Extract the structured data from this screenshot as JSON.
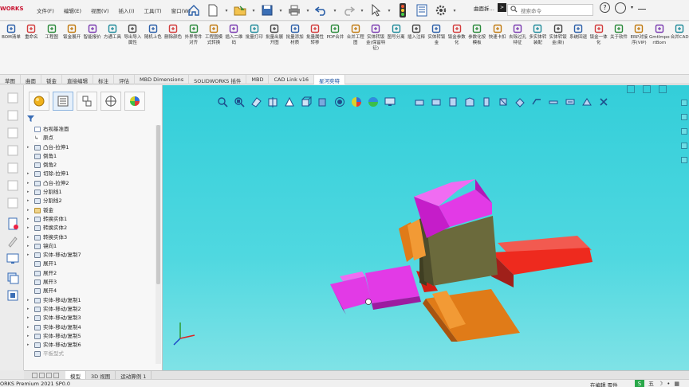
{
  "app": {
    "logo_text": "WORKS"
  },
  "menus": [
    "文件(F)",
    "编辑(E)",
    "视图(V)",
    "插入(I)",
    "工具(T)",
    "窗口(W)"
  ],
  "quick_access": [
    "home-icon",
    "new-file-icon",
    "open-folder-icon",
    "save-icon",
    "print-icon",
    "undo-icon",
    "redo-icon",
    "select-arrow-icon",
    "traffic-light-icon",
    "file-properties-icon",
    "options-gear-icon"
  ],
  "search": {
    "left_label": "曲面拆…",
    "placeholder": "搜索命令"
  },
  "commands": [
    {
      "label": "BOM清单",
      "icon": "bom-icon"
    },
    {
      "label": "重命名",
      "icon": "rename-icon"
    },
    {
      "label": "工程图",
      "icon": "drawing-icon"
    },
    {
      "label": "钣金展开",
      "icon": "sheetmetal-unfold-icon"
    },
    {
      "label": "智能报价",
      "icon": "quote-icon"
    },
    {
      "label": "方通工具",
      "icon": "tube-tool-icon"
    },
    {
      "label": "导出导入属性",
      "icon": "import-export-icon"
    },
    {
      "label": "随机上色",
      "icon": "random-color-icon"
    },
    {
      "label": "删除颜色",
      "icon": "delete-color-icon"
    },
    {
      "label": "外界零件对齐",
      "icon": "align-part-icon"
    },
    {
      "label": "工程图模式转换",
      "icon": "drawing-mode-icon"
    },
    {
      "label": "插入二维码",
      "icon": "qrcode-icon"
    },
    {
      "label": "批量打印",
      "icon": "batch-print-icon"
    },
    {
      "label": "批量出展开图",
      "icon": "batch-unfold-icon"
    },
    {
      "label": "批量添加材质",
      "icon": "batch-material-icon"
    },
    {
      "label": "批量属性转移",
      "icon": "batch-property-icon"
    },
    {
      "label": "PDF合并",
      "icon": "pdf-merge-icon"
    },
    {
      "label": "合并工程图",
      "icon": "merge-drawing-icon"
    },
    {
      "label": "实体转钣金(保留特征)",
      "icon": "solid-to-sheet-icon"
    },
    {
      "label": "图号分离",
      "icon": "number-split-icon"
    },
    {
      "label": "插入注释",
      "icon": "insert-note-icon"
    },
    {
      "label": "实体转钣金",
      "icon": "solid-to-sheetmetal-icon"
    },
    {
      "label": "钣金参数化",
      "icon": "sheet-param-icon"
    },
    {
      "label": "参数化按模板",
      "icon": "param-template-icon"
    },
    {
      "label": "快速卡扣",
      "icon": "snap-fit-icon"
    },
    {
      "label": "去除过孔特征",
      "icon": "remove-hole-icon"
    },
    {
      "label": "多实体转装配",
      "icon": "multibody-asm-icon"
    },
    {
      "label": "实体转钣金(新)",
      "icon": "solid-sheet-new-icon"
    },
    {
      "label": "系统回退",
      "icon": "system-rollback-icon"
    },
    {
      "label": "钣金一体化",
      "icon": "sheet-integrate-icon"
    },
    {
      "label": "关于软件",
      "icon": "about-icon"
    },
    {
      "label": "ERP对接序(VIP)",
      "icon": "erp-icon"
    },
    {
      "label": "GmtImportBom",
      "icon": "gmt-import-icon"
    },
    {
      "label": "合并CAD",
      "icon": "merge-cad-icon"
    }
  ],
  "tabs": [
    {
      "label": "草图",
      "active": false
    },
    {
      "label": "曲面",
      "active": false
    },
    {
      "label": "钣金",
      "active": false
    },
    {
      "label": "直接编辑",
      "active": false
    },
    {
      "label": "标注",
      "active": false
    },
    {
      "label": "评估",
      "active": false
    },
    {
      "label": "MBD Dimensions",
      "active": false
    },
    {
      "label": "SOLIDWORKS 插件",
      "active": false
    },
    {
      "label": "MBD",
      "active": false
    },
    {
      "label": "CAD Link v16",
      "active": false
    },
    {
      "label": "星河奕特",
      "active": true
    }
  ],
  "feature_tree": [
    {
      "label": "右视基准面",
      "icon": "plane",
      "toggle": ""
    },
    {
      "label": "原点",
      "icon": "origin",
      "toggle": ""
    },
    {
      "label": "凸台-拉伸1",
      "icon": "feature",
      "toggle": "▸"
    },
    {
      "label": "倒角1",
      "icon": "feature",
      "toggle": ""
    },
    {
      "label": "倒角2",
      "icon": "feature",
      "toggle": ""
    },
    {
      "label": "切除-拉伸1",
      "icon": "feature",
      "toggle": "▸"
    },
    {
      "label": "凸台-拉伸2",
      "icon": "feature",
      "toggle": "▸"
    },
    {
      "label": "分割线1",
      "icon": "feature",
      "toggle": "▸"
    },
    {
      "label": "分割线2",
      "icon": "feature",
      "toggle": "▸"
    },
    {
      "label": "钣金",
      "icon": "folder",
      "toggle": "▸"
    },
    {
      "label": "转换实体1",
      "icon": "feature",
      "toggle": "▸"
    },
    {
      "label": "转换实体2",
      "icon": "feature",
      "toggle": "▸"
    },
    {
      "label": "转换实体3",
      "icon": "feature",
      "toggle": "▸"
    },
    {
      "label": "镜向1",
      "icon": "feature",
      "toggle": "▸"
    },
    {
      "label": "实体-移动/复制7",
      "icon": "feature",
      "toggle": "▸"
    },
    {
      "label": "展开1",
      "icon": "feature",
      "toggle": ""
    },
    {
      "label": "展开2",
      "icon": "feature",
      "toggle": ""
    },
    {
      "label": "展开3",
      "icon": "feature",
      "toggle": ""
    },
    {
      "label": "展开4",
      "icon": "feature",
      "toggle": ""
    },
    {
      "label": "实体-移动/复制1",
      "icon": "feature",
      "toggle": "▸"
    },
    {
      "label": "实体-移动/复制2",
      "icon": "feature",
      "toggle": "▸"
    },
    {
      "label": "实体-移动/复制3",
      "icon": "feature",
      "toggle": "▸"
    },
    {
      "label": "实体-移动/复制4",
      "icon": "feature",
      "toggle": "▸"
    },
    {
      "label": "实体-移动/复制5",
      "icon": "feature",
      "toggle": "▸"
    },
    {
      "label": "实体-移动/复制6",
      "icon": "feature",
      "toggle": "▸"
    },
    {
      "label": "平板型式",
      "icon": "feature",
      "toggle": "",
      "dim": true
    }
  ],
  "bottom_tabs": [
    {
      "label": "模型",
      "active": true
    },
    {
      "label": "3D 视图",
      "active": false
    },
    {
      "label": "运动算例 1",
      "active": false
    }
  ],
  "status": {
    "left": "ORKS Premium 2021 SP0.0",
    "right": "在编辑 零件",
    "ime": "五"
  },
  "colors": {
    "viewport_bg": "#4fd8e0",
    "magenta_part": "#e23ae6",
    "orange_part": "#e07b18",
    "red_part": "#ee2a1e",
    "olive_part": "#6b6a3c"
  }
}
